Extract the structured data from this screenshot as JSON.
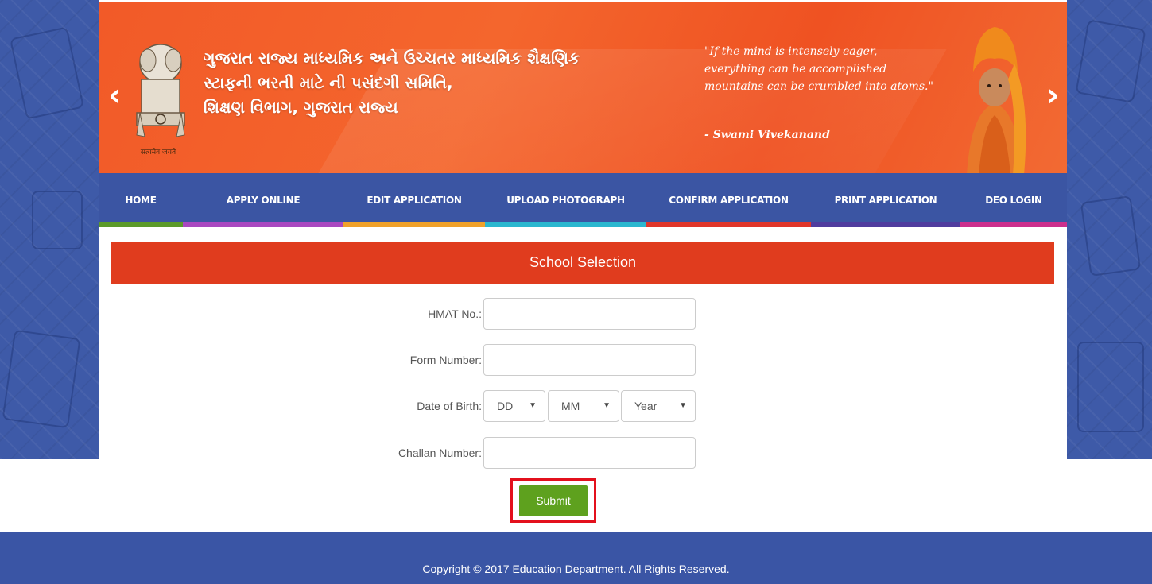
{
  "banner": {
    "title_lines": [
      "ગુજરાત રાજ્ય માધ્યમિક અને ઉચ્ચતર માધ્યમિક શૈક્ષણિક",
      "સ્ટાફની ભરતી માટે ની પસંદગી સમિતિ,",
      "શિક્ષણ વિભાગ, ગુજરાત રાજ્ય"
    ],
    "emblem_caption": "सत्यमेव जयते",
    "quote_lines": [
      "\"If the mind is intensely eager,",
      "everything can be accomplished",
      "mountains can be crumbled into atoms.\""
    ],
    "quote_author": "- Swami Vivekanand",
    "prev_arrow": "‹",
    "next_arrow": "›"
  },
  "nav": {
    "items": [
      {
        "label": "HOME",
        "color": "#5b9a2a"
      },
      {
        "label": "APPLY ONLINE",
        "color": "#a948c0"
      },
      {
        "label": "EDIT APPLICATION",
        "color": "#f0a12a"
      },
      {
        "label": "UPLOAD PHOTOGRAPH",
        "color": "#2bb7cf"
      },
      {
        "label": "CONFIRM APPLICATION",
        "color": "#e0362a"
      },
      {
        "label": "PRINT APPLICATION",
        "color": "#503c9e"
      },
      {
        "label": "DEO LOGIN",
        "color": "#cc2f8c"
      }
    ]
  },
  "panel": {
    "title": "School Selection"
  },
  "form": {
    "hmat_label": "HMAT No.:",
    "hmat_value": "",
    "form_number_label": "Form Number:",
    "form_number_value": "",
    "dob_label": "Date of Birth:",
    "dob_day": "DD",
    "dob_month": "MM",
    "dob_year": "Year",
    "challan_label": "Challan Number:",
    "challan_value": "",
    "submit_label": "Submit"
  },
  "footer": {
    "copyright": "Copyright © 2017 Education Department. All Rights Reserved."
  },
  "colors": {
    "banner": "#f25a28",
    "nav": "#3b55a3",
    "panel_head": "#e03c1e",
    "submit": "#5ea11e",
    "highlight": "#e3101c"
  }
}
